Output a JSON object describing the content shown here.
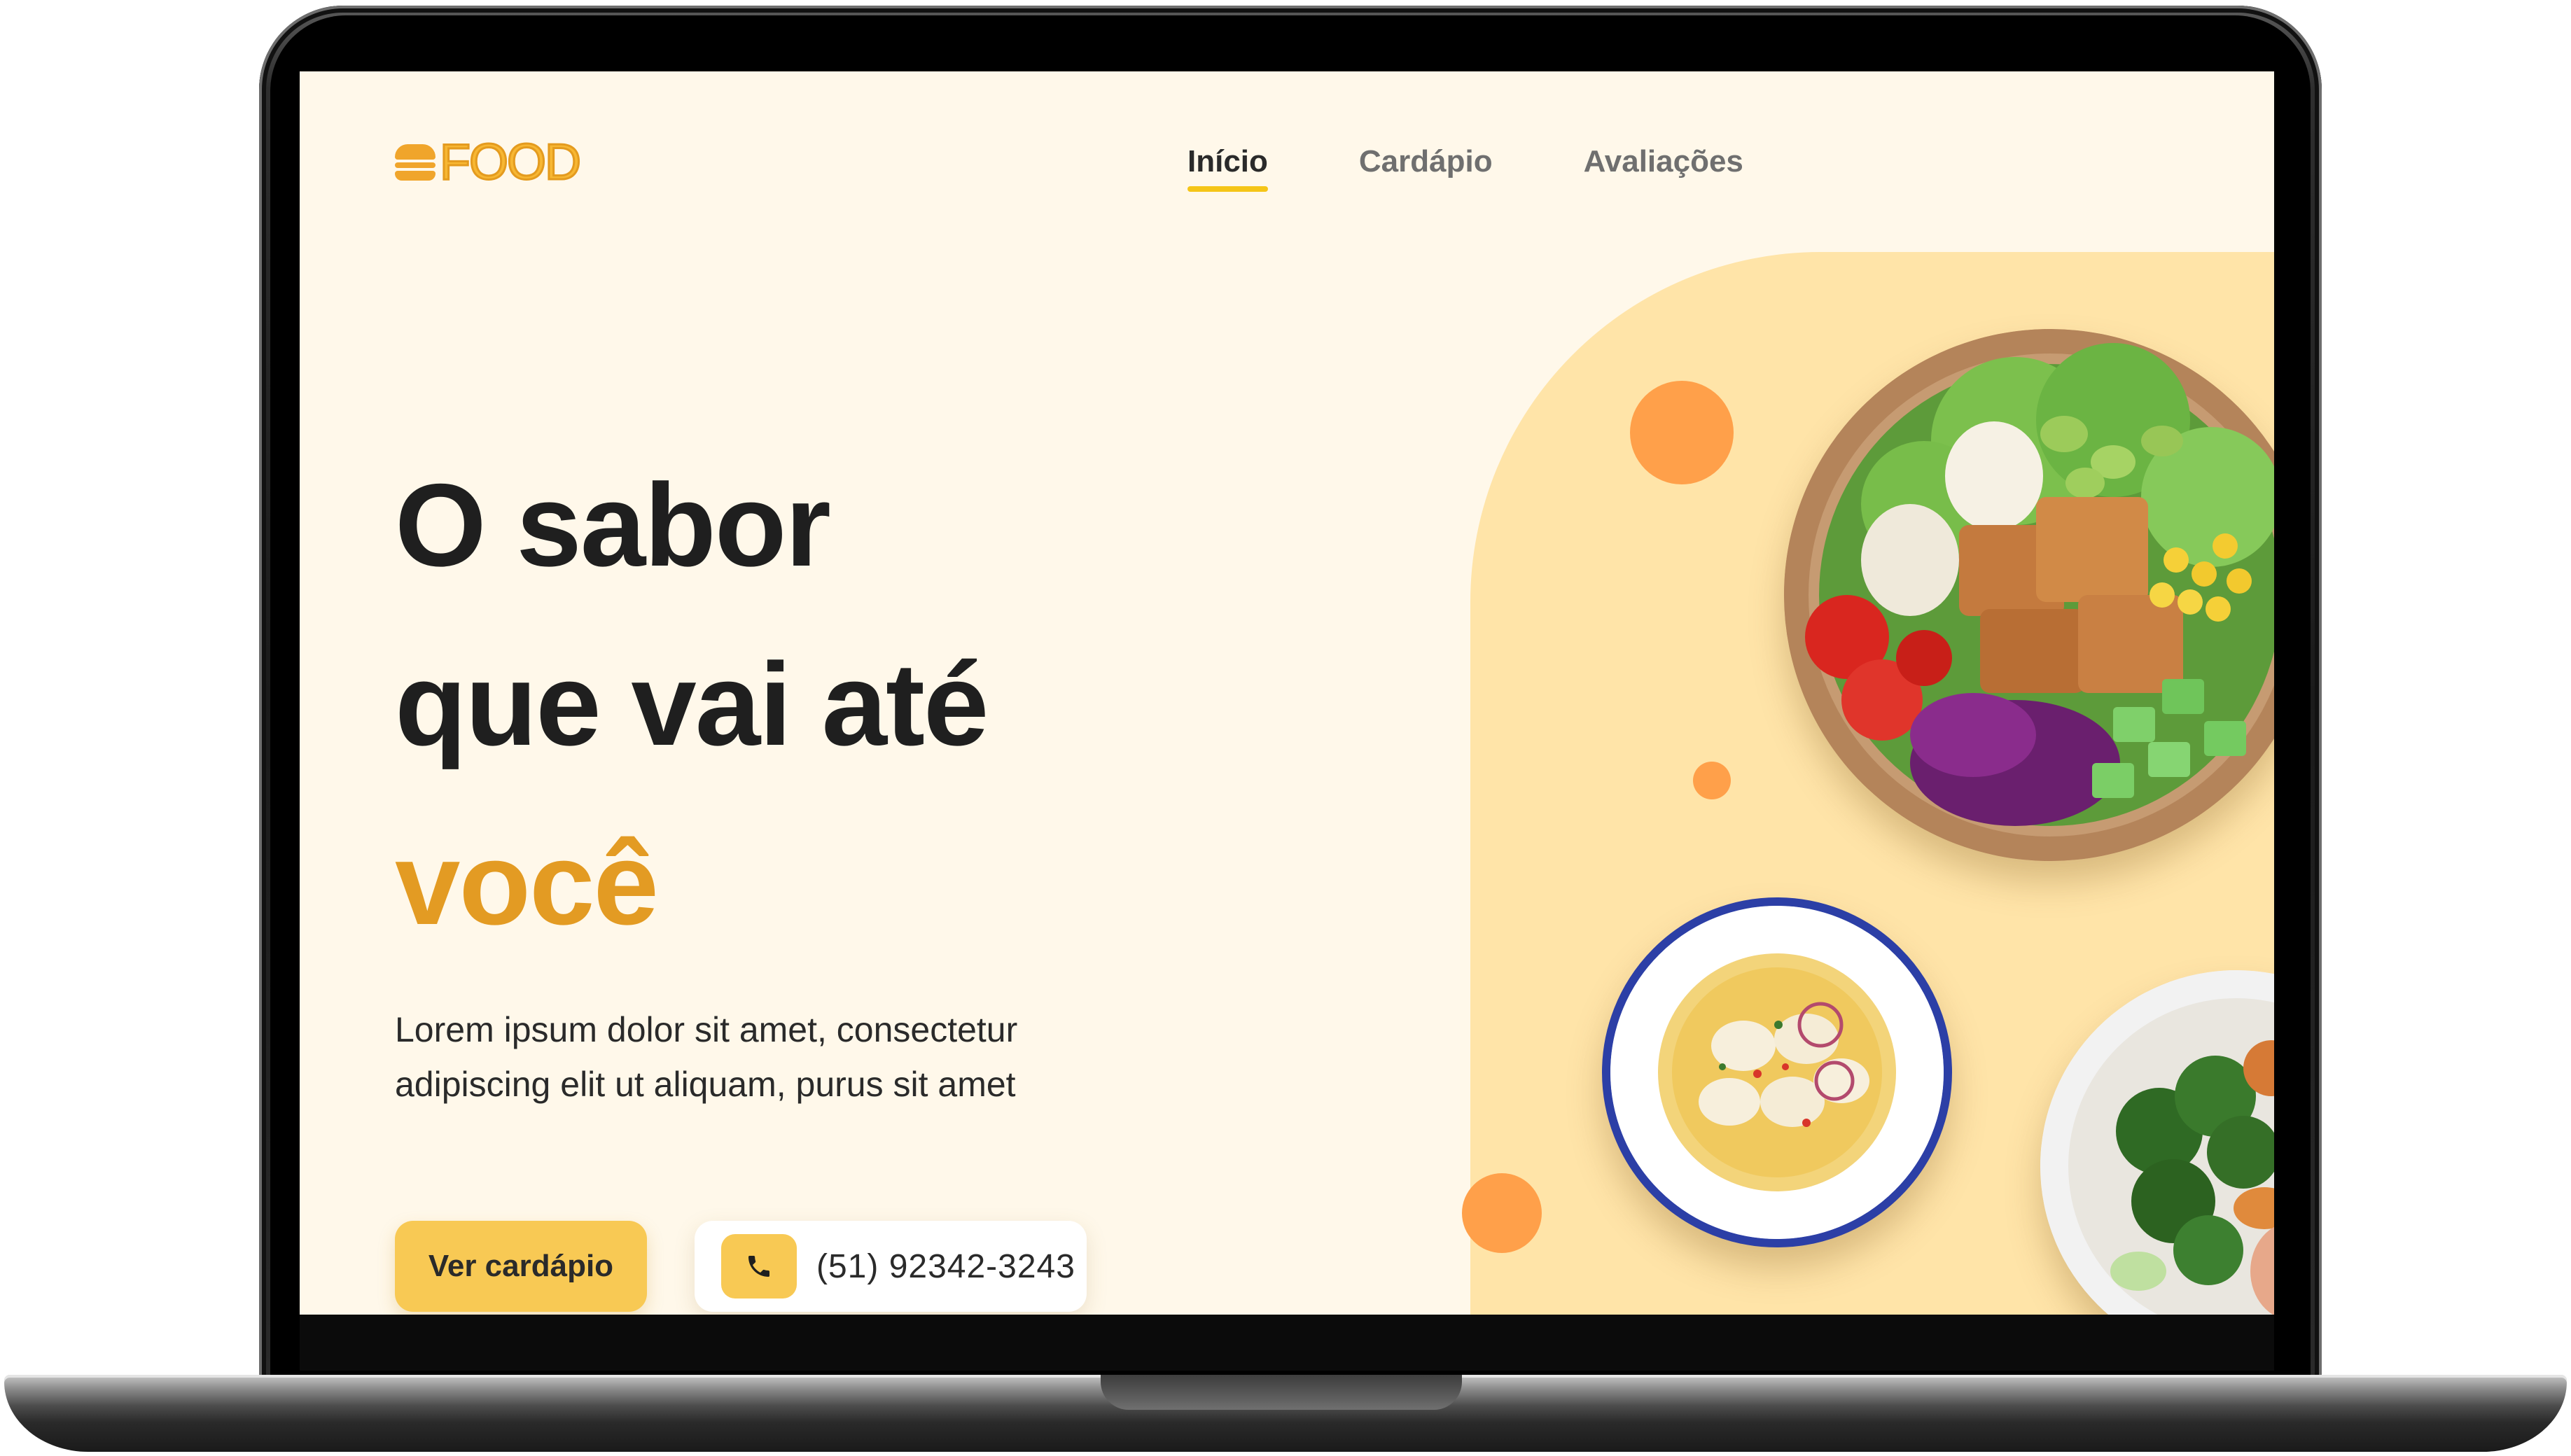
{
  "brand": {
    "logo_text": "FOOD"
  },
  "nav": {
    "items": [
      {
        "label": "Início",
        "active": true
      },
      {
        "label": "Cardápio",
        "active": false
      },
      {
        "label": "Avaliações",
        "active": false
      }
    ]
  },
  "hero": {
    "title_line_1": "O sabor",
    "title_line_2": "que vai até",
    "title_line_3": "você",
    "description": "Lorem ipsum dolor sit amet, consectetur adipiscing elit ut aliquam, purus sit amet",
    "cta_label": "Ver cardápio",
    "phone": "(51) 92342-3243"
  },
  "icons": {
    "logo": "burger-icon",
    "phone": "phone-icon"
  },
  "colors": {
    "background": "#fff8ea",
    "accent": "#e39b23",
    "button": "#f8c954",
    "blob": "#ffe4a8",
    "dot": "#ffa04a",
    "nav_underline": "#f5c518"
  }
}
